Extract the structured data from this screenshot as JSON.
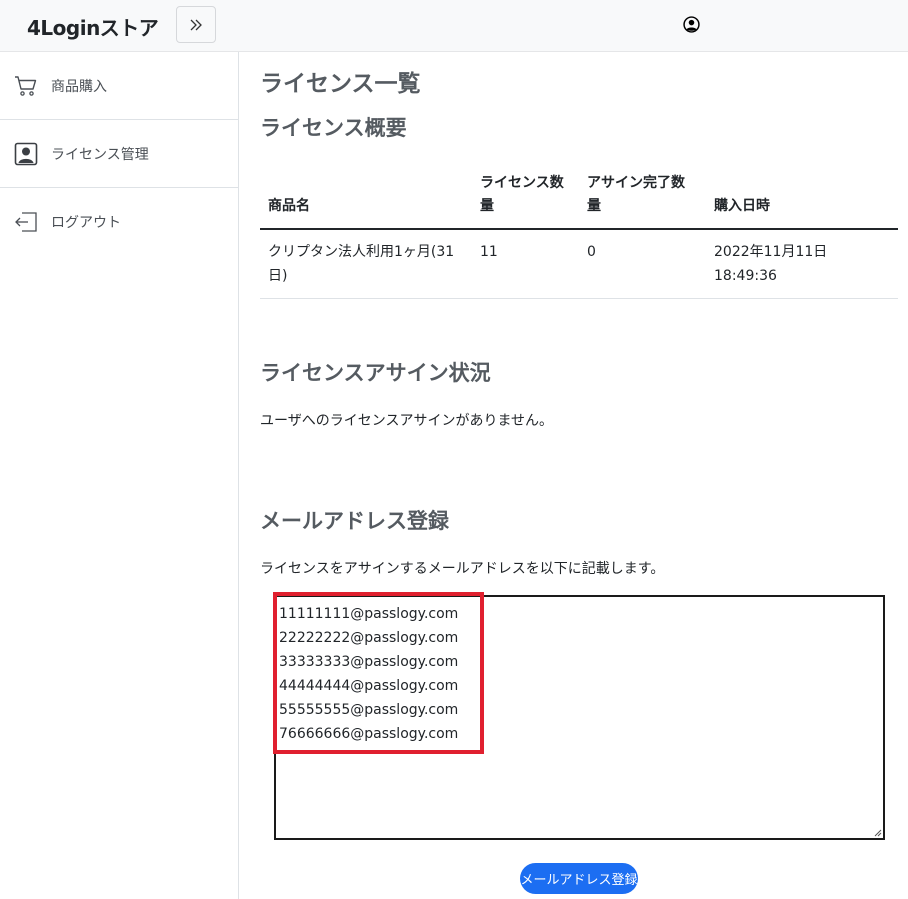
{
  "header": {
    "brand": "4Loginストア",
    "toggle_icon": "double-chevron-right-icon",
    "user_icon": "user-circle-icon"
  },
  "sidebar": {
    "items": [
      {
        "label": "商品購入",
        "icon": "cart-icon"
      },
      {
        "label": "ライセンス管理",
        "icon": "user-badge-icon"
      },
      {
        "label": "ログアウト",
        "icon": "logout-icon"
      }
    ]
  },
  "main": {
    "page_title": "ライセンス一覧",
    "summary": {
      "title": "ライセンス概要",
      "columns": [
        "商品名",
        "ライセンス数量",
        "アサイン完了数量",
        "購入日時"
      ],
      "rows": [
        [
          "クリプタン法人利用1ヶ月(31日)",
          "11",
          "0",
          "2022年11月11日 18:49:36"
        ]
      ]
    },
    "assign_status": {
      "title": "ライセンスアサイン状況",
      "message": "ユーザへのライセンスアサインがありません。"
    },
    "email_register": {
      "title": "メールアドレス登録",
      "description": "ライセンスをアサインするメールアドレスを以下に記載します。",
      "emails": [
        "11111111@passlogy.com",
        "22222222@passlogy.com",
        "33333333@passlogy.com",
        "44444444@passlogy.com",
        "55555555@passlogy.com",
        "76666666@passlogy.com"
      ],
      "button_label": "メールアドレス登録"
    }
  },
  "colors": {
    "accent": "#1c6ef2",
    "highlight": "#e0202f",
    "heading": "#555b61"
  }
}
